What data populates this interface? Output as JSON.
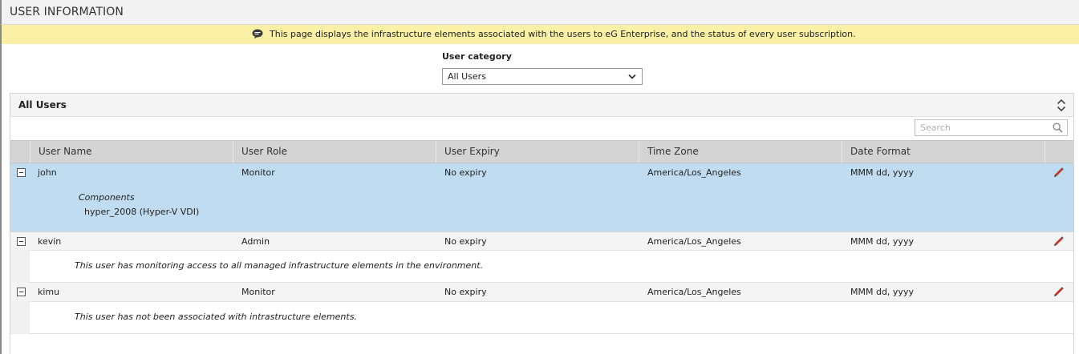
{
  "page": {
    "title": "USER INFORMATION",
    "banner": "This page displays the infrastructure elements associated with the users to eG Enterprise, and the status of every user subscription."
  },
  "filter": {
    "label": "User category",
    "selected": "All Users"
  },
  "panel": {
    "title": "All Users",
    "search_placeholder": "Search"
  },
  "table": {
    "columns": [
      "User Name",
      "User Role",
      "User Expiry",
      "Time Zone",
      "Date Format"
    ],
    "rows": [
      {
        "name": "john",
        "role": "Monitor",
        "expiry": "No expiry",
        "timezone": "America/Los_Angeles",
        "dateformat": "MMM dd, yyyy",
        "detail_heading": "Components",
        "detail_text": "hyper_2008 (Hyper-V VDI)"
      },
      {
        "name": "kevin",
        "role": "Admin",
        "expiry": "No expiry",
        "timezone": "America/Los_Angeles",
        "dateformat": "MMM dd, yyyy",
        "detail_text": "This user has monitoring access to all managed infrastructure elements in the environment."
      },
      {
        "name": "kimu",
        "role": "Monitor",
        "expiry": "No expiry",
        "timezone": "America/Los_Angeles",
        "dateformat": "MMM dd, yyyy",
        "detail_text": "This user has not been associated with intrastructure elements."
      }
    ]
  },
  "icons": {
    "banner": "speech-bubble-icon",
    "dropdown": "chevron-down-icon",
    "panel_toggle": "expand-collapse-icon",
    "search": "search-icon",
    "row_toggle": "minus-box-icon",
    "edit": "pencil-icon"
  },
  "colors": {
    "banner_bg": "#fbf1a6",
    "selected_row_bg": "#bfdcf0",
    "header_bg": "#d4d4d4",
    "edit_icon": "#c0392b"
  }
}
